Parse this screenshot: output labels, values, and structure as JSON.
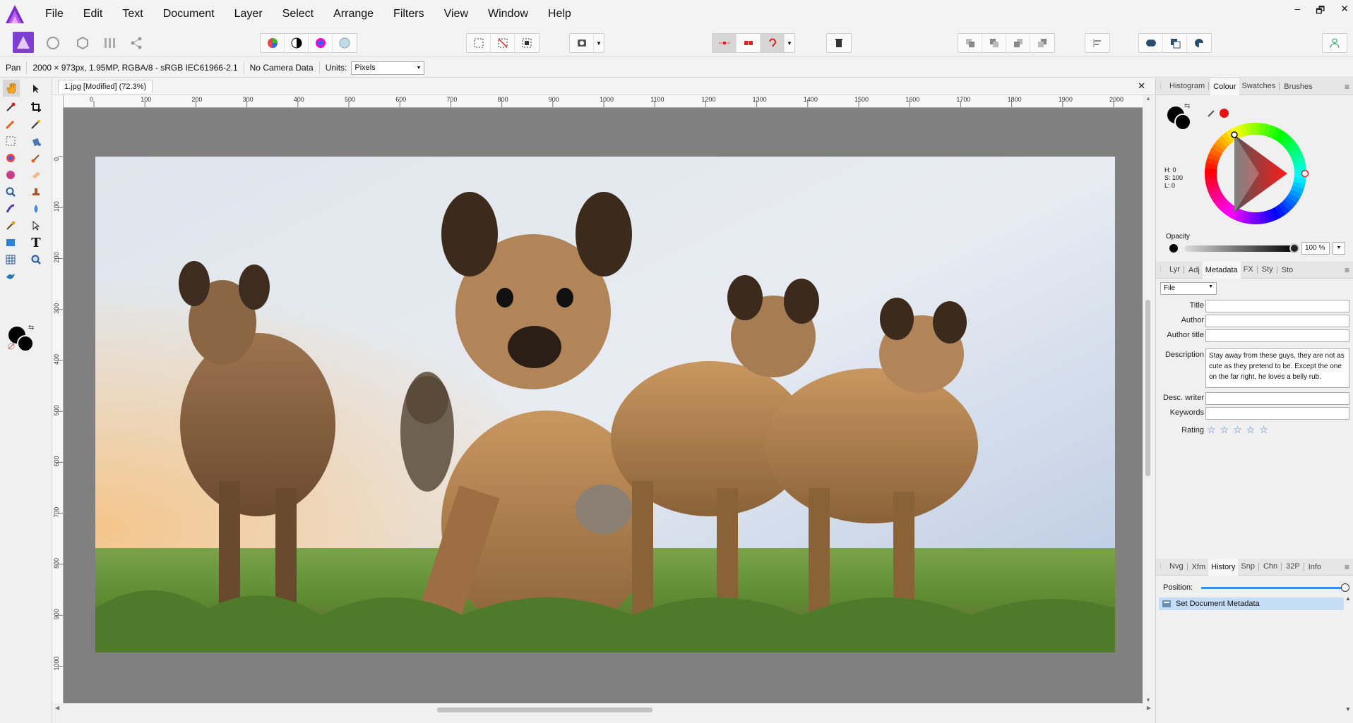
{
  "menubar": {
    "items": [
      "File",
      "Edit",
      "Text",
      "Document",
      "Layer",
      "Select",
      "Arrange",
      "Filters",
      "View",
      "Window",
      "Help"
    ],
    "window_controls": [
      "–",
      "🗗",
      "✕"
    ]
  },
  "contextbar": {
    "tool": "Pan",
    "doc_info": "2000 × 973px, 1.95MP, RGBA/8 - sRGB IEC61966-2.1",
    "camera": "No Camera Data",
    "units_label": "Units:",
    "units_value": "Pixels"
  },
  "document": {
    "title": "1.jpg [Modified] (72.3%)",
    "close": "✕",
    "ruler_unit": "px",
    "hruler": [
      {
        "v": "0",
        "p": 0
      },
      {
        "v": "100",
        "p": 100
      },
      {
        "v": "200",
        "p": 200
      },
      {
        "v": "300",
        "p": 300
      },
      {
        "v": "400",
        "p": 400
      },
      {
        "v": "500",
        "p": 500
      },
      {
        "v": "600",
        "p": 600
      },
      {
        "v": "700",
        "p": 700
      },
      {
        "v": "800",
        "p": 800
      },
      {
        "v": "900",
        "p": 900
      },
      {
        "v": "1000",
        "p": 1000
      },
      {
        "v": "1100",
        "p": 1100
      },
      {
        "v": "1200",
        "p": 1200
      },
      {
        "v": "1300",
        "p": 1300
      },
      {
        "v": "1400",
        "p": 1400
      },
      {
        "v": "1500",
        "p": 1500
      },
      {
        "v": "1600",
        "p": 1600
      },
      {
        "v": "1700",
        "p": 1700
      },
      {
        "v": "1800",
        "p": 1800
      },
      {
        "v": "1900",
        "p": 1900
      },
      {
        "v": "2000",
        "p": 2000
      }
    ],
    "vruler": [
      {
        "v": "0",
        "p": 0
      },
      {
        "v": "100",
        "p": 100
      },
      {
        "v": "200",
        "p": 200
      },
      {
        "v": "300",
        "p": 300
      },
      {
        "v": "400",
        "p": 400
      },
      {
        "v": "500",
        "p": 500
      },
      {
        "v": "600",
        "p": 600
      },
      {
        "v": "700",
        "p": 700
      },
      {
        "v": "800",
        "p": 800
      },
      {
        "v": "900",
        "p": 900
      },
      {
        "v": "1000",
        "p": 1000
      }
    ]
  },
  "colour_panel": {
    "tabs": [
      "Histogram",
      "Colour",
      "Swatches",
      "Brushes"
    ],
    "active_tab": "Colour",
    "h": "H: 0",
    "s": "S: 100",
    "l": "L: 0",
    "opacity_label": "Opacity",
    "opacity_value": "100 %"
  },
  "metadata_panel": {
    "tabs": [
      "Lyr",
      "Adj",
      "Metadata",
      "FX",
      "Sty",
      "Sto"
    ],
    "active_tab": "Metadata",
    "select_value": "File",
    "labels": {
      "title": "Title",
      "author": "Author",
      "author_title": "Author title",
      "description": "Description",
      "desc_writer": "Desc. writer",
      "keywords": "Keywords",
      "rating": "Rating"
    },
    "description_value": "Stay away from these guys, they are not as cute as they pretend to be. Except the one on the far right, he loves a belly rub.",
    "rating": 0,
    "rating_max": 5
  },
  "history_panel": {
    "tabs": [
      "Nvg",
      "Xfm",
      "History",
      "Snp",
      "Chn",
      "32P",
      "Info"
    ],
    "active_tab": "History",
    "position_label": "Position:",
    "position_fraction": 1.0,
    "entries": [
      "Set Document Metadata"
    ]
  },
  "colors": {
    "primary": "#000000",
    "secondary": "#e81010",
    "accent": "#2e8ff0",
    "selection": "#c5ddf7"
  }
}
